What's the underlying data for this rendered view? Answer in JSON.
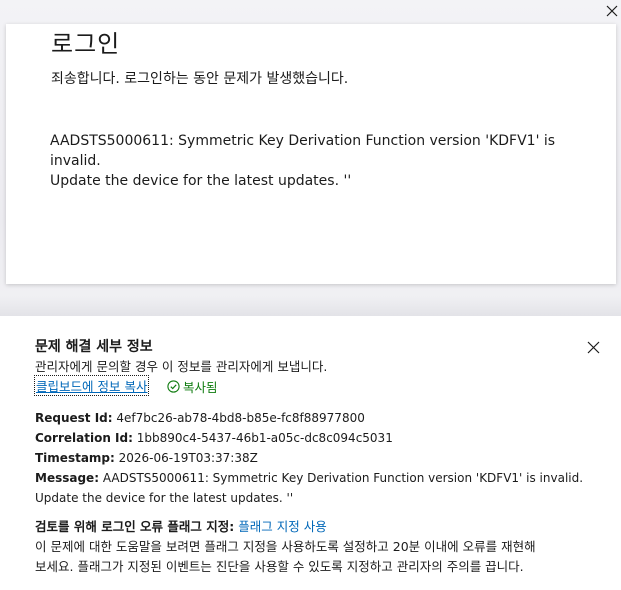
{
  "window": {
    "close_icon": "close-icon"
  },
  "login_card": {
    "title": "로그인",
    "subtitle": "죄송합니다. 로그인하는 동안 문제가 발생했습니다.",
    "error_line1": "AADSTS5000611: Symmetric Key Derivation Function version 'KDFV1' is invalid.",
    "error_line2": "Update the device for the latest updates. ''"
  },
  "troubleshoot": {
    "title": "문제 해결 세부 정보",
    "description": "관리자에게 문의할 경우 이 정보를 관리자에게 보냅니다.",
    "copy_link": "클립보드에 정보 복사",
    "copied_label": "복사됨",
    "close_icon": "close-icon",
    "details": {
      "request_id_label": "Request Id:",
      "request_id": "4ef7bc26-ab78-4bd8-b85e-fc8f88977800",
      "correlation_id_label": "Correlation Id:",
      "correlation_id": "1bb890c4-5437-46b1-a05c-dc8c094c5031",
      "timestamp_label": "Timestamp:",
      "timestamp": "2026-06-19T03:37:38Z",
      "message_label": "Message:",
      "message_line1": "AADSTS5000611: Symmetric Key Derivation Function version 'KDFV1' is invalid.",
      "message_line2": "Update the device for the latest updates. ''"
    },
    "flag": {
      "heading": "검토를 위해 로그인 오류 플래그 지정:",
      "link": "플래그 지정 사용",
      "body_line1": "이 문제에 대한 도움말을 보려면 플래그 지정을 사용하도록 설정하고 20분 이내에 오류를 재현해",
      "body_line2": "보세요. 플래그가 지정된 이벤트는 진단을 사용할 수 있도록 지정하고 관리자의 주의를 끕니다."
    }
  },
  "colors": {
    "link": "#0067b8",
    "success": "#107c10",
    "text": "#1b1b1b"
  }
}
